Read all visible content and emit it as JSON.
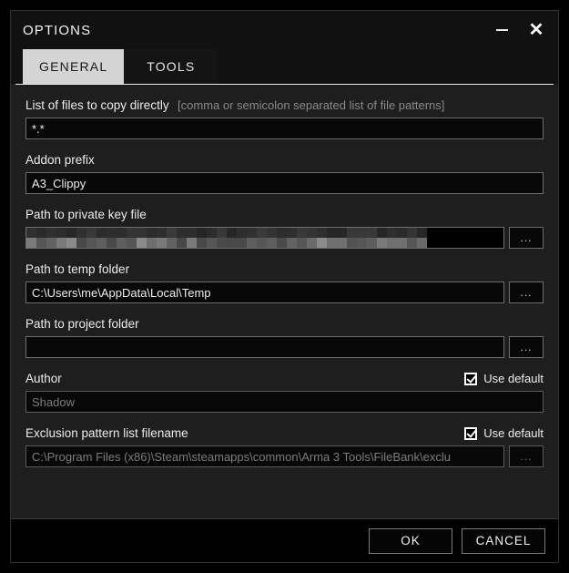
{
  "window": {
    "title": "OPTIONS",
    "minimize_icon": "minimize-icon",
    "close_icon": "close-icon"
  },
  "tabs": [
    {
      "label": "GENERAL",
      "active": true
    },
    {
      "label": "TOOLS",
      "active": false
    }
  ],
  "fields": [
    {
      "label": "List of files to copy directly",
      "hint": "[comma or semicolon separated list of file patterns]",
      "value": "*.*",
      "has_browse": false,
      "disabled": false
    },
    {
      "label": "Addon prefix",
      "hint": "",
      "value": "A3_Clippy",
      "has_browse": false,
      "disabled": false
    },
    {
      "label": "Path to private key file",
      "hint": "",
      "value": "",
      "redacted": true,
      "has_browse": true,
      "browse_label": "...",
      "disabled": false
    },
    {
      "label": "Path to temp folder",
      "hint": "",
      "value": "C:\\Users\\me\\AppData\\Local\\Temp",
      "has_browse": true,
      "browse_label": "...",
      "disabled": false
    },
    {
      "label": "Path to project folder",
      "hint": "",
      "value": "",
      "has_browse": true,
      "browse_label": "...",
      "disabled": false
    },
    {
      "label": "Author",
      "hint": "",
      "value": "Shadow",
      "has_browse": false,
      "disabled": true,
      "checkbox": {
        "label": "Use default",
        "checked": true
      }
    },
    {
      "label": "Exclusion pattern list filename",
      "hint": "",
      "value": "C:\\Program Files (x86)\\Steam\\steamapps\\common\\Arma 3 Tools\\FileBank\\exclu",
      "has_browse": true,
      "browse_label": "...",
      "disabled": true,
      "checkbox": {
        "label": "Use default",
        "checked": true
      }
    }
  ],
  "footer": {
    "ok_label": "OK",
    "cancel_label": "CANCEL"
  },
  "colors": {
    "window_bg": "#1e1e1e",
    "titlebar_bg": "#111111",
    "active_tab_bg": "#d4d4d4",
    "input_bg": "#080808",
    "input_border": "#6e6e6e",
    "text": "#ececec",
    "hint_text": "#8a8a8a",
    "disabled_text": "#7c7c7c",
    "footer_bg": "#000000"
  }
}
